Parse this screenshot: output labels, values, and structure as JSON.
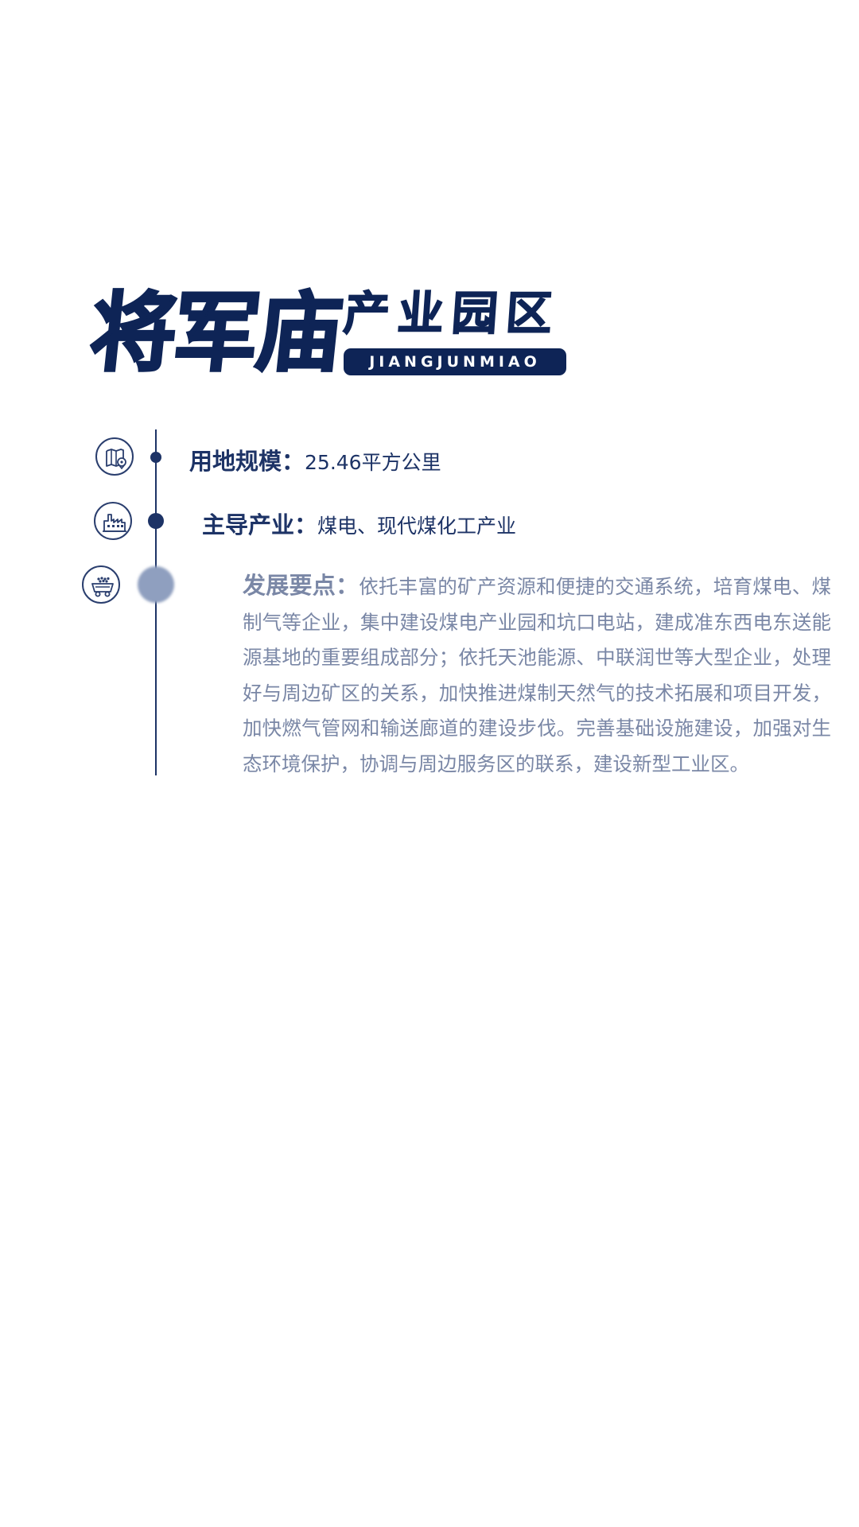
{
  "title": {
    "main": "将军庙",
    "sub": "产业园区",
    "pinyin": "JIANGJUNMIAO"
  },
  "colors": {
    "primary": "#0e2456",
    "text_dark": "#1d3366",
    "text_muted": "#7a87a6",
    "faded_dot": "#8f9fbf"
  },
  "items": [
    {
      "icon": "map-location-icon",
      "label": "用地规模：",
      "value": "25.46平方公里"
    },
    {
      "icon": "factory-icon",
      "label": "主导产业：",
      "value": "煤电、现代煤化工产业"
    },
    {
      "icon": "mine-cart-icon",
      "label": "发展要点：",
      "value": "依托丰富的矿产资源和便捷的交通系统，培育煤电、煤制气等企业，集中建设煤电产业园和坑口电站，建成准东西电东送能源基地的重要组成部分；依托天池能源、中联润世等大型企业，处理好与周边矿区的关系，加快推进煤制天然气的技术拓展和项目开发，加快燃气管网和输送廊道的建设步伐。完善基础设施建设，加强对生态环境保护，协调与周边服务区的联系，建设新型工业区。"
    }
  ]
}
